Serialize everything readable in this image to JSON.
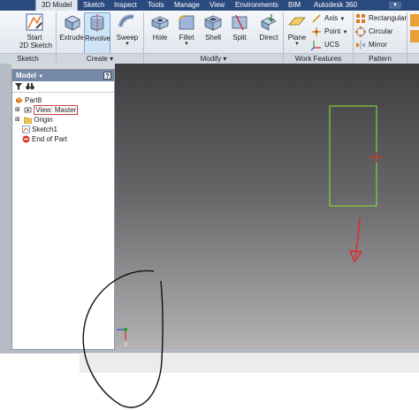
{
  "tabs": [
    {
      "label": "3D Model",
      "active": true
    },
    {
      "label": "Sketch"
    },
    {
      "label": "Inspect"
    },
    {
      "label": "Tools"
    },
    {
      "label": "Manage"
    },
    {
      "label": "View"
    },
    {
      "label": "Environments"
    },
    {
      "label": "BIM"
    },
    {
      "label": "Autodesk 360"
    }
  ],
  "ribbon": {
    "sketch": {
      "start_line1": "Start",
      "start_line2": "2D Sketch",
      "panel": "Sketch"
    },
    "create": {
      "extrude": "Extrude",
      "revolve": "Revolve",
      "sweep": "Sweep",
      "panel": "Create"
    },
    "modify": {
      "hole": "Hole",
      "fillet": "Fillet",
      "shell": "Shell",
      "split": "Split",
      "direct": "Direct",
      "panel": "Modify"
    },
    "work": {
      "plane": "Plane",
      "axis": "Axis",
      "point": "Point",
      "ucs": "UCS",
      "panel": "Work Features"
    },
    "pattern": {
      "rectangular": "Rectangular",
      "circular": "Circular",
      "mirror": "Mirror",
      "panel": "Pattern"
    },
    "colors": {
      "accent": "#2a4a7e",
      "sketch_line": "#7fd13b",
      "constraint": "#e0302a"
    }
  },
  "browser": {
    "title": "Model",
    "help": "?",
    "items": [
      {
        "label": "Part8",
        "icon": "part-icon"
      },
      {
        "label": "View: Master",
        "icon": "view-icon"
      },
      {
        "label": "Origin",
        "icon": "folder-icon"
      },
      {
        "label": "Sketch1",
        "icon": "sketch-icon"
      },
      {
        "label": "End of Part",
        "icon": "end-of-part-icon"
      }
    ]
  },
  "viewport": {
    "triad": {
      "z": "Z",
      "x": "X"
    }
  }
}
